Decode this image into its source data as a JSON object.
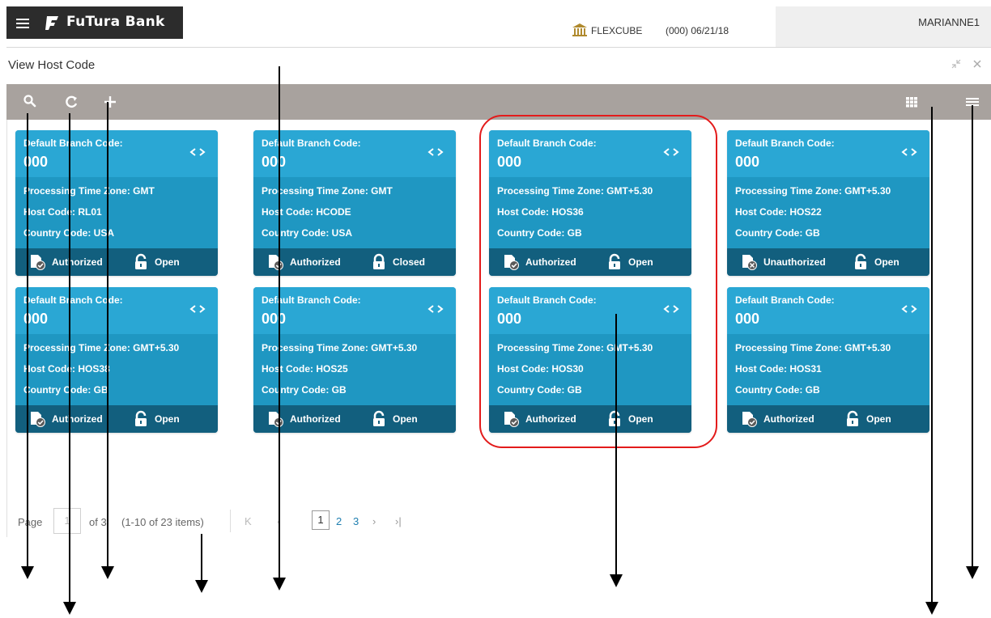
{
  "header": {
    "brand_name": "FuTura Bank",
    "product": "FLEXCUBE",
    "branch_date": "(000)  06/21/18",
    "user": "MARIANNE1"
  },
  "screen": {
    "title": "View Host Code"
  },
  "toolbar": {
    "icons": [
      "search-icon",
      "refresh-icon",
      "add-icon",
      "tile-view-icon",
      "list-view-icon"
    ]
  },
  "colors": {
    "tile_header": "#2aa7d4",
    "tile_body": "#1f97c2",
    "tile_footer": "#125f7e",
    "toolbar": "#a8a29e",
    "highlight": "#e31b1b"
  },
  "tiles": [
    {
      "label": "Default Branch Code:",
      "code": "000",
      "tz_label": "Processing Time Zone:",
      "tz": "GMT",
      "host_label": "Host Code:",
      "host": "RL01",
      "country_label": "Country Code:",
      "country": "USA",
      "auth": "Authorized",
      "status": "Open"
    },
    {
      "label": "Default Branch Code:",
      "code": "000",
      "tz_label": "Processing Time Zone:",
      "tz": "GMT",
      "host_label": "Host Code:",
      "host": "HCODE",
      "country_label": "Country Code:",
      "country": "USA",
      "auth": "Authorized",
      "status": "Closed"
    },
    {
      "label": "Default Branch Code:",
      "code": "000",
      "tz_label": "Processing Time Zone:",
      "tz": "GMT+5.30",
      "host_label": "Host Code:",
      "host": "HOS36",
      "country_label": "Country Code:",
      "country": "GB",
      "auth": "Authorized",
      "status": "Open"
    },
    {
      "label": "Default Branch Code:",
      "code": "000",
      "tz_label": "Processing Time Zone:",
      "tz": "GMT+5.30",
      "host_label": "Host Code:",
      "host": "HOS22",
      "country_label": "Country Code:",
      "country": "GB",
      "auth": "Unauthorized",
      "status": "Open"
    },
    {
      "label": "Default Branch Code:",
      "code": "000",
      "tz_label": "Processing Time Zone:",
      "tz": "GMT+5.30",
      "host_label": "Host Code:",
      "host": "HOS38",
      "country_label": "Country Code:",
      "country": "GB",
      "auth": "Authorized",
      "status": "Open"
    },
    {
      "label": "Default Branch Code:",
      "code": "000",
      "tz_label": "Processing Time Zone:",
      "tz": "GMT+5.30",
      "host_label": "Host Code:",
      "host": "HOS25",
      "country_label": "Country Code:",
      "country": "GB",
      "auth": "Authorized",
      "status": "Open"
    },
    {
      "label": "Default Branch Code:",
      "code": "000",
      "tz_label": "Processing Time Zone:",
      "tz": "GMT+5.30",
      "host_label": "Host Code:",
      "host": "HOS30",
      "country_label": "Country Code:",
      "country": "GB",
      "auth": "Authorized",
      "status": "Open"
    },
    {
      "label": "Default Branch Code:",
      "code": "000",
      "tz_label": "Processing Time Zone:",
      "tz": "GMT+5.30",
      "host_label": "Host Code:",
      "host": "HOS31",
      "country_label": "Country Code:",
      "country": "GB",
      "auth": "Authorized",
      "status": "Open"
    }
  ],
  "pagination": {
    "page_label": "Page",
    "current_page_value": "1",
    "of_label": "of 3",
    "items_summary": "(1-10 of 23 items)",
    "first": "K",
    "prev": "‹",
    "next": "›",
    "last": "›|",
    "pages": [
      "1",
      "2",
      "3"
    ],
    "current": "1"
  }
}
